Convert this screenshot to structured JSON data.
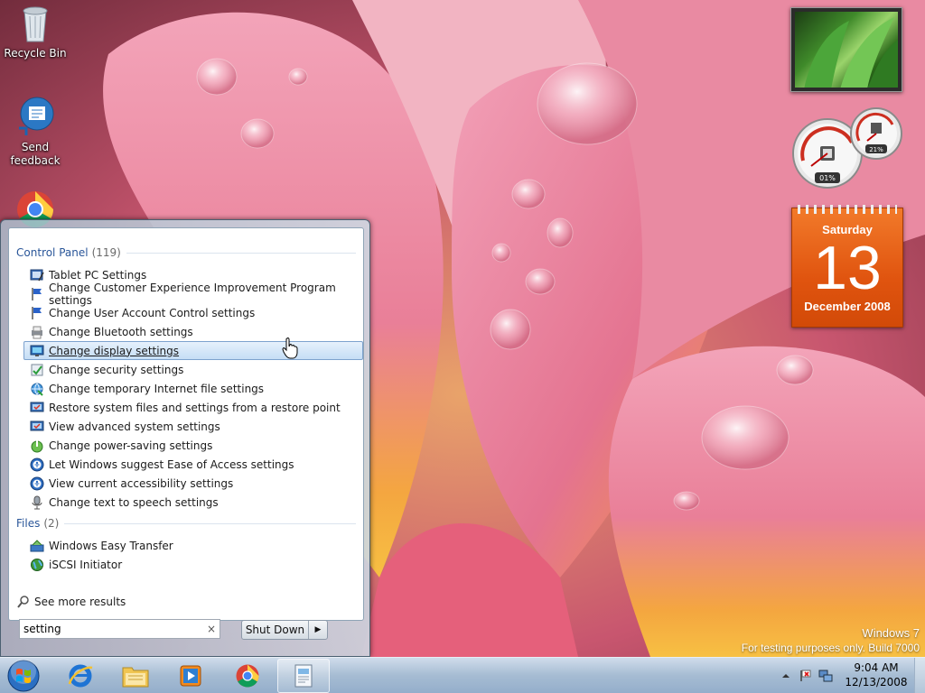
{
  "desktop": {
    "icons": [
      {
        "label": "Recycle Bin",
        "icon": "recycle-bin-icon"
      },
      {
        "label": "Send feedback",
        "icon": "feedback-icon"
      },
      {
        "label": "",
        "icon": "chrome-icon"
      }
    ]
  },
  "gadgets": {
    "meter": {
      "cpu": "01%",
      "memory": "21%"
    },
    "calendar": {
      "weekday": "Saturday",
      "day": "13",
      "month_year": "December 2008"
    }
  },
  "watermark": {
    "line1": "Windows 7",
    "line2": "For testing purposes only. Build 7000"
  },
  "start_menu": {
    "groups": [
      {
        "title": "Control Panel",
        "count": "(119)",
        "items": [
          {
            "label": "Tablet PC Settings",
            "icon": "tablet-pc-icon"
          },
          {
            "label": "Change Customer Experience Improvement Program settings",
            "icon": "flag-icon"
          },
          {
            "label": "Change User Account Control settings",
            "icon": "flag-icon"
          },
          {
            "label": "Change Bluetooth settings",
            "icon": "printer-icon"
          },
          {
            "label": "Change display settings",
            "icon": "display-icon",
            "selected": true
          },
          {
            "label": "Change security settings",
            "icon": "security-icon"
          },
          {
            "label": "Change temporary Internet file settings",
            "icon": "internet-options-icon"
          },
          {
            "label": "Restore system files and settings from a restore point",
            "icon": "system-icon"
          },
          {
            "label": "View advanced system settings",
            "icon": "system-icon"
          },
          {
            "label": "Change power-saving settings",
            "icon": "power-icon"
          },
          {
            "label": "Let Windows suggest Ease of Access settings",
            "icon": "ease-of-access-icon"
          },
          {
            "label": "View current accessibility settings",
            "icon": "ease-of-access-icon"
          },
          {
            "label": "Change text to speech settings",
            "icon": "microphone-icon"
          }
        ]
      },
      {
        "title": "Files",
        "count": "(2)",
        "items": [
          {
            "label": "Windows Easy Transfer",
            "icon": "easy-transfer-icon"
          },
          {
            "label": "iSCSI Initiator",
            "icon": "globe-icon"
          }
        ]
      }
    ],
    "see_more": "See more results",
    "search": {
      "value": "setting",
      "clear": "×"
    },
    "shutdown_label": "Shut Down",
    "shutdown_arrow": "▶"
  },
  "taskbar": {
    "pinned": [
      "internet-explorer-icon",
      "folder-icon",
      "media-player-icon",
      "chrome-icon",
      "document-icon"
    ],
    "tray_icons": [
      "show-hidden-icons-icon",
      "action-center-icon",
      "network-icon"
    ],
    "clock": {
      "time": "9:04 AM",
      "date": "12/13/2008"
    }
  },
  "colors": {
    "accent": "#2a5699",
    "selection": "#c5def5",
    "calendar": "#e0540f"
  }
}
